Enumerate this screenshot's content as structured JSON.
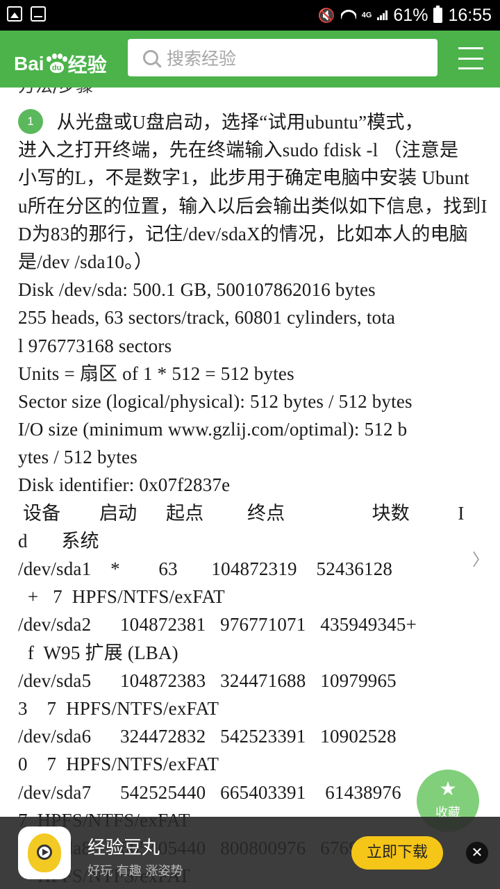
{
  "status_bar": {
    "network_small": "4G",
    "network_small2": "4G\n2G",
    "battery_percent": "61%",
    "time": "16:55"
  },
  "header": {
    "logo_text_left": "Bai",
    "logo_text_mid": "du",
    "logo_text_right": "经验",
    "search_placeholder": "搜索经验",
    "accent_color": "#4bb34a"
  },
  "content": {
    "section_heading_partial": "方法/步骤",
    "step_number": "1",
    "lines": [
      "        从光盘或U盘启动，选择“试用ubuntu”模式，",
      "进入之打开终端，先在终端输入sudo fdisk -l （注意是",
      "小写的L，不是数字1，此步用于确定电脑中安装 Ubunt",
      "u所在分区的位置，输入以后会输出类似如下信息，找到I",
      "D为83的那行，记住/dev/sdaX的情况，比如本人的电脑",
      "是/dev /sda10。）",
      "Disk /dev/sda: 500.1 GB, 500107862016 bytes",
      "255 heads, 63 sectors/track, 60801 cylinders, tota",
      "l 976773168 sectors",
      "Units = 扇区 of 1 * 512 = 512 bytes",
      "Sector size (logical/physical): 512 bytes / 512 bytes",
      "I/O size (minimum www.gzlij.com/optimal): 512 b",
      "ytes / 512 bytes",
      "Disk identifier: 0x07f2837e",
      " 设备        启动      起点         终点                  块数          I",
      "d       系统",
      "/dev/sda1    *        63       104872319    52436128",
      "  +   7  HPFS/NTFS/exFAT",
      "/dev/sda2      104872381   976771071   435949345+",
      "  f  W95 扩展 (LBA)",
      "/dev/sda5      104872383   324471688   10979965",
      "3    7  HPFS/NTFS/exFAT",
      "/dev/sda6      324472832   542523391   10902528",
      "0    7  HPFS/NTFS/exFAT",
      "/dev/sda7      542525440   665403391    61438976",
      "7  HPFS/NTFS/exFAT",
      "/dev/sda8      665405440   800800976   67697768+",
      "    HPFS/NTFS/exFAT"
    ]
  },
  "fab": {
    "label": "收藏",
    "icon": "star-icon"
  },
  "banner": {
    "app_name": "经验豆丸",
    "tagline": "好玩 有趣 涨姿势",
    "download_label": "立即下载",
    "close_symbol": "✕",
    "button_color": "#f5c518"
  }
}
